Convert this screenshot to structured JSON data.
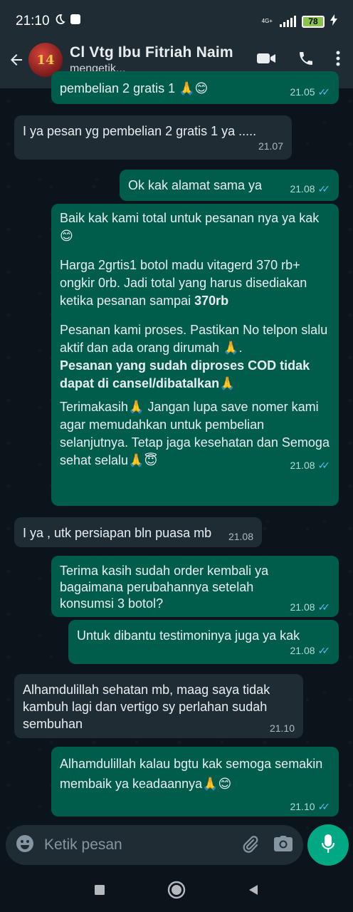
{
  "status_bar": {
    "time": "21:10",
    "network_label": "4G+",
    "battery_level": "78",
    "icons": [
      "moon-icon",
      "notification-square-icon",
      "signal-icon",
      "battery-icon",
      "charging-bolt-icon"
    ]
  },
  "header": {
    "contact_name": "Cl Vtg Ibu Fitriah Naim",
    "status": "mengetik...",
    "avatar_text": "14",
    "icons": [
      "back-arrow-icon",
      "video-call-icon",
      "phone-icon",
      "more-vert-icon"
    ]
  },
  "messages": [
    {
      "direction": "out",
      "text": "pembelian 2 gratis 1",
      "emoji": "🙏😊",
      "time": "21.05"
    },
    {
      "direction": "in",
      "text": "I ya pesan yg pembelian 2 gratis 1 ya .....",
      "time": "21.07"
    },
    {
      "direction": "out",
      "text": "Ok kak alamat sama ya",
      "time": "21.08"
    },
    {
      "direction": "out",
      "time": "21.08",
      "p1": "Baik kak kami total untuk pesanan nya ya kak",
      "p1_emoji": "😊",
      "p2": "Harga 2grtis1 botol madu vitagerd 370 rb+ ongkir 0rb. Jadi total yang harus disediakan ketika pesanan sampai ",
      "p2_bold": "370rb",
      "p3": "Pesanan kami proses. Pastikan No telpon slalu aktif dan ada orang dirumah ",
      "p3_emoji": "🙏",
      "p3_end": ".",
      "p3_bold": "Pesanan yang sudah diproses COD tidak dapat di cansel/dibatalkan",
      "p3_bold_emoji": "🙏",
      "p4a": " Terimakasih",
      "p4_emoji1": "🙏",
      "p4b": " Jangan lupa save nomer kami agar memudahkan untuk pembelian selanjutnya. Tetap jaga kesehatan dan Semoga sehat selalu",
      "p4_emoji2": "🙏😇"
    },
    {
      "direction": "in",
      "text": "I ya , utk persiapan bln puasa mb",
      "time": "21.08"
    },
    {
      "direction": "out",
      "text": "Terima kasih sudah order kembali ya bagaimana perubahannya setelah konsumsi 3 botol?",
      "time": "21.08"
    },
    {
      "direction": "out",
      "text": "Untuk dibantu testimoninya juga ya kak",
      "time": "21.08"
    },
    {
      "direction": "in",
      "text": "Alhamdulillah sehatan mb, maag saya tidak kambuh lagi dan vertigo sy perlahan sudah sembuhan",
      "time": "21.10"
    },
    {
      "direction": "out",
      "text": "Alhamdulillah kalau bgtu kak semoga semakin membaik ya keadaannya",
      "emoji": "🙏😊",
      "time": "21.10"
    }
  ],
  "input": {
    "placeholder": "Ketik pesan",
    "icons": [
      "emoji-icon",
      "attach-icon",
      "camera-icon",
      "mic-icon"
    ]
  },
  "nav": {
    "icons": [
      "recents-square-icon",
      "home-circle-icon",
      "back-triangle-icon"
    ]
  },
  "colors": {
    "outgoing_bubble": "#005c4b",
    "incoming_bubble": "#1f2c33",
    "background": "#0b141a",
    "accent": "#00a884",
    "read_tick": "#53bdeb"
  }
}
